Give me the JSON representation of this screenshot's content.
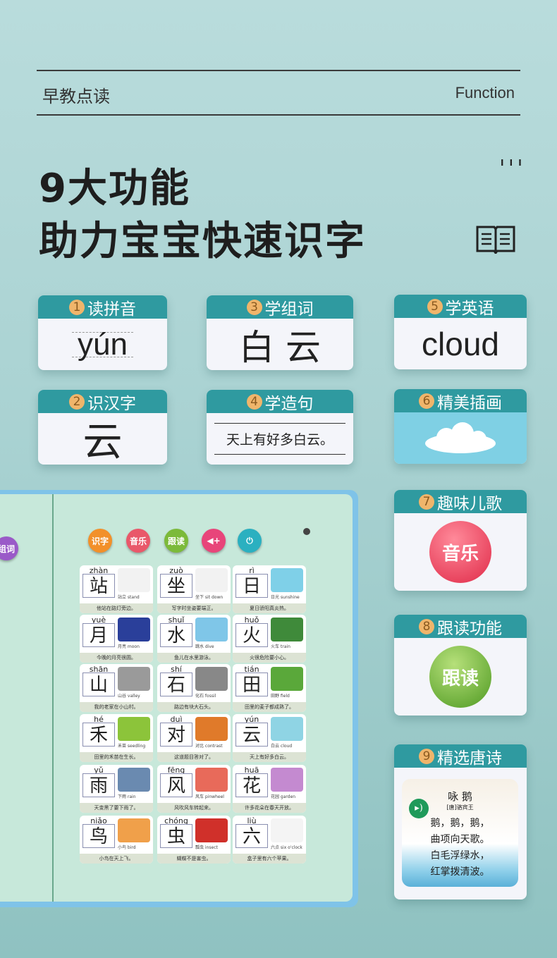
{
  "header": {
    "section_cn": "早教点读",
    "section_en": "Function",
    "title_line1": "9大功能",
    "title_line2": "助力宝宝快速识字",
    "book_icon": "open-book-icon"
  },
  "features": [
    {
      "num": "1",
      "label": "读拼音",
      "content": "yún"
    },
    {
      "num": "2",
      "label": "识汉字",
      "content": "云"
    },
    {
      "num": "3",
      "label": "学组词",
      "content": "白 云"
    },
    {
      "num": "4",
      "label": "学造句",
      "content": "天上有好多白云。"
    },
    {
      "num": "5",
      "label": "学英语",
      "content": "cloud"
    },
    {
      "num": "6",
      "label": "精美插画",
      "content": "cloud-illustration"
    },
    {
      "num": "7",
      "label": "趣味儿歌",
      "content": "音乐"
    },
    {
      "num": "8",
      "label": "跟读功能",
      "content": "跟读"
    },
    {
      "num": "9",
      "label": "精选唐诗",
      "content": "poem"
    }
  ],
  "poem": {
    "title": "咏 鹅",
    "author": "[唐]骆宾王",
    "lines": [
      "鹅，鹅，鹅，",
      "曲项向天歌。",
      "白毛浮绿水，",
      "红掌拨清波。"
    ],
    "icon": "speaker-icon"
  },
  "book": {
    "buttons": [
      {
        "label": "识字",
        "color": "#f2902a"
      },
      {
        "label": "音乐",
        "color": "#e9586a"
      },
      {
        "label": "跟读",
        "color": "#7cba3a"
      },
      {
        "label": "volume-icon",
        "color": "#e8457a"
      },
      {
        "label": "power-icon",
        "color": "#2bb0c0"
      }
    ],
    "left_button": "组词",
    "cards": [
      {
        "py": "zhàn",
        "ch": "站",
        "word": "站立  stand",
        "sent": "他站在路灯旁边。",
        "color": "#f2f2f2"
      },
      {
        "py": "zuò",
        "ch": "坐",
        "word": "坐下  sit down",
        "sent": "写字时坐姿要端正。",
        "color": "#f2f2f2"
      },
      {
        "py": "rì",
        "ch": "日",
        "word": "日光  sunshine",
        "sent": "夏日骄阳真炎热。",
        "color": "#7fd0e8"
      },
      {
        "py": "yuè",
        "ch": "月",
        "word": "月亮  moon",
        "sent": "今晚的月亮很圆。",
        "color": "#2a3f9a"
      },
      {
        "py": "shuǐ",
        "ch": "水",
        "word": "跳水  dive",
        "sent": "鱼儿在水里游泳。",
        "color": "#7fc6e8"
      },
      {
        "py": "huǒ",
        "ch": "火",
        "word": "火车  train",
        "sent": "火很危险要小心。",
        "color": "#3f8a3a"
      },
      {
        "py": "shān",
        "ch": "山",
        "word": "山谷  valley",
        "sent": "我的老家在小山村。",
        "color": "#9a9a9a"
      },
      {
        "py": "shí",
        "ch": "石",
        "word": "化石  fossil",
        "sent": "路边有块大石头。",
        "color": "#888888"
      },
      {
        "py": "tián",
        "ch": "田",
        "word": "田野  field",
        "sent": "田里的麦子都成熟了。",
        "color": "#5aa83a"
      },
      {
        "py": "hé",
        "ch": "禾",
        "word": "禾苗  seedling",
        "sent": "田里的禾苗在生长。",
        "color": "#8cc43a"
      },
      {
        "py": "duì",
        "ch": "对",
        "word": "对比  contrast",
        "sent": "这道题目答对了。",
        "color": "#e07a2a"
      },
      {
        "py": "yún",
        "ch": "云",
        "word": "白云  cloud",
        "sent": "天上有好多白云。",
        "color": "#8fd4e4"
      },
      {
        "py": "yǔ",
        "ch": "雨",
        "word": "下雨  rain",
        "sent": "天变黑了要下雨了。",
        "color": "#6a8ab0"
      },
      {
        "py": "fēng",
        "ch": "风",
        "word": "风车  pinwheel",
        "sent": "风吹风车转起来。",
        "color": "#e86a5a"
      },
      {
        "py": "huā",
        "ch": "花",
        "word": "花园  garden",
        "sent": "许多花朵在春天开放。",
        "color": "#c48ad0"
      },
      {
        "py": "niǎo",
        "ch": "鸟",
        "word": "小鸟  bird",
        "sent": "小鸟在天上飞。",
        "color": "#f0a04a"
      },
      {
        "py": "chóng",
        "ch": "虫",
        "word": "瓢虫  insect",
        "sent": "蝴蝶不是害虫。",
        "color": "#d0302a"
      },
      {
        "py": "liù",
        "ch": "六",
        "word": "六点  six o'clock",
        "sent": "盒子里有六个苹果。",
        "color": "#f4f4f4"
      }
    ]
  },
  "colors": {
    "teal": "#2f9aa0",
    "badge": "#f0b56b",
    "bg": "#b9dcdc"
  }
}
